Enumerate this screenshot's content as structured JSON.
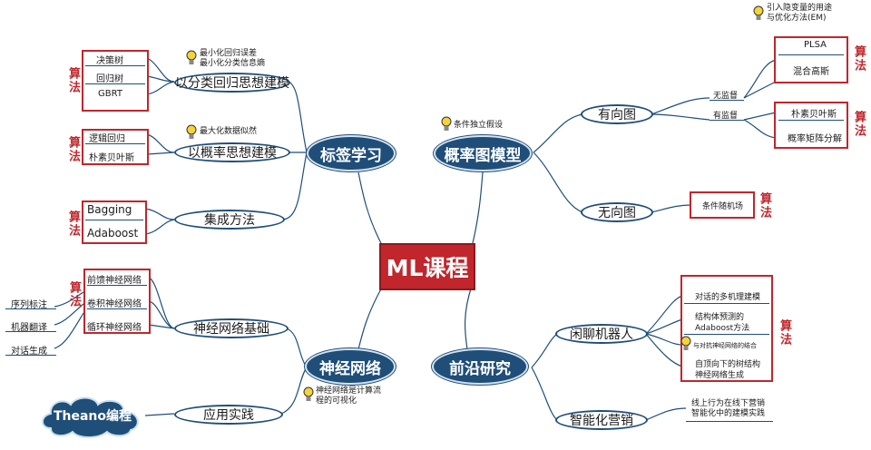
{
  "center": "ML课程",
  "label_tag": "算法",
  "left_top": {
    "label": "标签学习",
    "branches": [
      {
        "label": "以分类回归思想建模",
        "items": [
          "决策树",
          "回归树",
          "GBRT"
        ],
        "note": [
          "最小化回归误差",
          "最小化分类信息熵"
        ]
      },
      {
        "label": "以概率思想建模",
        "items": [
          "逻辑回归",
          "朴素贝叶斯"
        ],
        "note": [
          "最大化数据似然"
        ]
      },
      {
        "label": "集成方法",
        "items": [
          "Bagging",
          "Adaboost"
        ]
      }
    ]
  },
  "left_bottom": {
    "label": "神经网络",
    "note": [
      "神经网络是计算流",
      "程的可视化"
    ],
    "branches": [
      {
        "label": "神经网络基础",
        "items": [
          "前馈神经网络",
          "卷积神经网络",
          "循环神经网络"
        ],
        "apps": [
          "序列标注",
          "机器翻译",
          "对话生成"
        ]
      },
      {
        "label": "应用实践",
        "cloud": "Theano编程"
      }
    ]
  },
  "right_top": {
    "label": "概率图模型",
    "note": [
      "条件独立假设"
    ],
    "branches": [
      {
        "label": "有向图",
        "top_note": [
          "引入隐变量的用途",
          "与优化方法(EM)"
        ],
        "subs": [
          {
            "label": "无监督",
            "items": [
              "PLSA",
              "混合高斯"
            ]
          },
          {
            "label": "有监督",
            "items": [
              "朴素贝叶斯",
              "概率矩阵分解"
            ]
          }
        ]
      },
      {
        "label": "无向图",
        "items": [
          "条件随机场"
        ]
      }
    ]
  },
  "right_bottom": {
    "label": "前沿研究",
    "branches": [
      {
        "label": "闲聊机器人",
        "items": [
          "对话的多机理建模",
          "结构体预测的",
          "Adaboost方法",
          "自顶向下的树结构",
          "神经网络生成"
        ],
        "note": [
          "与对抗神经网络的结合"
        ]
      },
      {
        "label": "智能化营销",
        "note": [
          "线上行为在线下营销",
          "智能化中的建模实践"
        ]
      }
    ]
  }
}
